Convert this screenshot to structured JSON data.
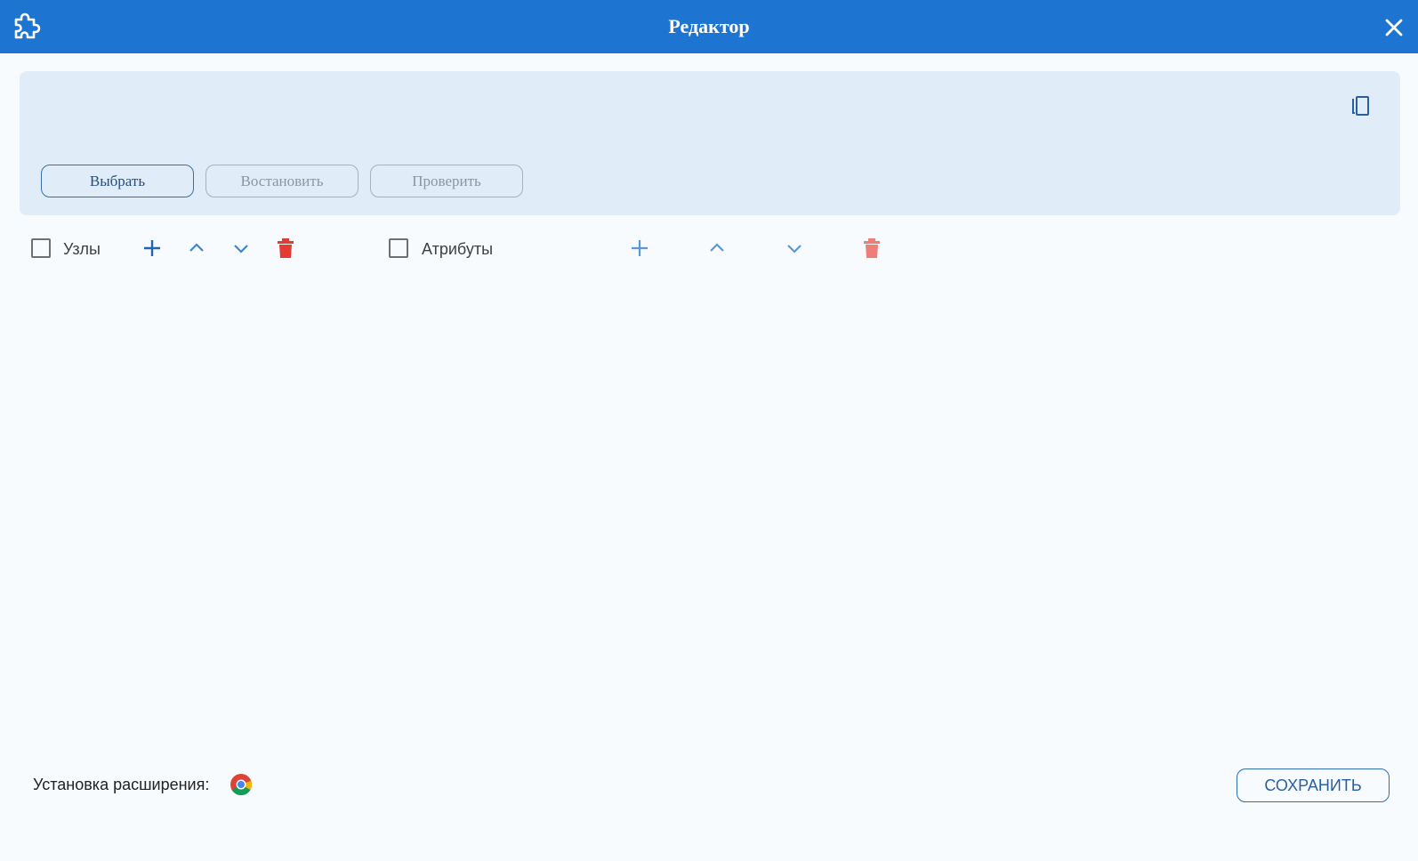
{
  "window": {
    "title": "Редактор",
    "app_icon": "puzzle-piece-icon",
    "close_icon": "close-icon"
  },
  "top_panel": {
    "copy_icon": "copy-icon",
    "buttons": {
      "select": "Выбрать",
      "restore": "Востановить",
      "check": "Проверить"
    }
  },
  "toolbar": {
    "nodes": {
      "label": "Узлы",
      "checked": false
    },
    "attributes": {
      "label": "Атрибуты",
      "checked": false
    },
    "icons": [
      "plus-icon",
      "chevron-up-icon",
      "chevron-down-icon",
      "trash-icon"
    ]
  },
  "footer": {
    "install_label": "Установка расширения:",
    "browser_icon": "chrome-icon",
    "save_label": "СОХРАНИТЬ"
  },
  "colors": {
    "header": "#1d75d1",
    "panel": "#e0ecf8",
    "accent": "#2f6db3",
    "delete": "#e33b32",
    "delete_faded": "#ef7d78"
  }
}
